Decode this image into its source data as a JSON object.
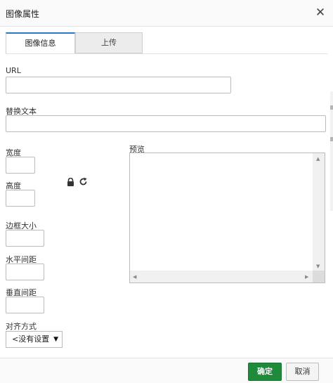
{
  "dialog": {
    "title": "图像属性",
    "close_symbol": "✕"
  },
  "tabs": [
    {
      "label": "图像信息"
    },
    {
      "label": "上传"
    }
  ],
  "fields": {
    "url": {
      "label": "URL",
      "value": ""
    },
    "alt": {
      "label": "替换文本",
      "value": ""
    },
    "width": {
      "label": "宽度",
      "value": ""
    },
    "height": {
      "label": "高度",
      "value": ""
    },
    "border": {
      "label": "边框大小",
      "value": ""
    },
    "hspace": {
      "label": "水平间距",
      "value": ""
    },
    "vspace": {
      "label": "垂直间距",
      "value": ""
    },
    "align": {
      "label": "对齐方式",
      "selected": "<没有设置"
    }
  },
  "icons": {
    "lock": "lock-icon",
    "reset": "reset-size-icon",
    "lock_glyph": "🔒",
    "reset_glyph": "↻"
  },
  "preview": {
    "label": "预览"
  },
  "footer": {
    "ok_label": "确定",
    "cancel_label": "取消"
  },
  "colors": {
    "ok_button": "#1f8a3a",
    "active_tab_accent": "#2b78c5"
  }
}
